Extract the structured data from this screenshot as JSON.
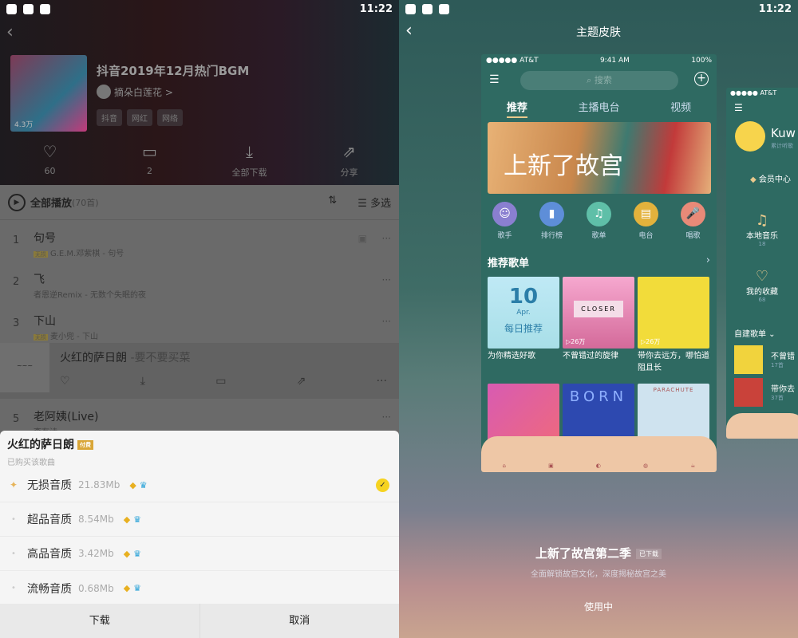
{
  "status": {
    "time": "11:22"
  },
  "left": {
    "playlist": {
      "title": "抖音2019年12月热门BGM",
      "creator": "摘朵白莲花 >",
      "tags": [
        "抖音",
        "网红",
        "网络"
      ],
      "cover_play_count": "4.3万"
    },
    "actions": [
      {
        "icon": "heart-icon",
        "label": "60"
      },
      {
        "icon": "comment-icon",
        "label": "2"
      },
      {
        "icon": "download-icon",
        "label": "全部下载"
      },
      {
        "icon": "share-icon",
        "label": "分享"
      }
    ],
    "play_all": {
      "label": "全部播放",
      "count": "(70首)",
      "multi_select": "多选"
    },
    "songs": [
      {
        "n": "1",
        "title": "句号",
        "sub": "G.E.M.邓紫棋 - 句号",
        "badge": "无损"
      },
      {
        "n": "2",
        "title": "飞",
        "sub": "者恩逆Remix - 无数个失眠的夜",
        "badge": ""
      },
      {
        "n": "3",
        "title": "下山",
        "sub": "麦小兜 - 下山",
        "badge": "无损"
      },
      {
        "n": "4",
        "title": "火红的萨日朗",
        "sub": " -要不要买菜",
        "badge": ""
      },
      {
        "n": "5",
        "title": "老阿姨(Live)",
        "sub": "李有诗",
        "badge": ""
      }
    ],
    "sheet": {
      "title": "火红的萨日朗",
      "badge": "付费",
      "subtitle": "已购买该歌曲",
      "qualities": [
        {
          "name": "无损音质",
          "size": "21.83Mb",
          "selected": true
        },
        {
          "name": "超品音质",
          "size": "8.54Mb",
          "selected": false
        },
        {
          "name": "高品音质",
          "size": "3.42Mb",
          "selected": false
        },
        {
          "name": "流畅音质",
          "size": "0.68Mb",
          "selected": false
        }
      ],
      "download": "下载",
      "cancel": "取消"
    }
  },
  "right": {
    "title": "主题皮肤",
    "preview": {
      "carrier": "●●●●● AT&T",
      "time": "9:41 AM",
      "battery": "100%",
      "search": "搜索",
      "tabs": [
        "推荐",
        "主播电台",
        "视频"
      ],
      "banner": "上新了故宫",
      "categories": [
        {
          "label": "歌手",
          "color": "#8a7fd0"
        },
        {
          "label": "排行榜",
          "color": "#5e8ed8"
        },
        {
          "label": "歌单",
          "color": "#5fbfa8"
        },
        {
          "label": "电台",
          "color": "#e3b23c"
        },
        {
          "label": "唱歌",
          "color": "#e88a78"
        }
      ],
      "section": "推荐歌单",
      "tiles": [
        {
          "caption": "为你精选好歌",
          "day": "10",
          "month": "Apr.",
          "label": "每日推荐",
          "plays": ""
        },
        {
          "caption": "不曾错过的旋律",
          "label": "CLOSER",
          "plays": "26万"
        },
        {
          "caption": "带你去远方，哪怕道阻且长",
          "plays": "26万"
        },
        {
          "caption": ""
        },
        {
          "caption": "",
          "label": "BORN"
        },
        {
          "caption": "",
          "label": "PARACHUTE"
        }
      ]
    },
    "side": {
      "carrier": "●●●●● AT&T",
      "name": "Kuw",
      "sub": "累计听歌",
      "vip": "会员中心",
      "items": [
        {
          "label": "本地音乐",
          "count": "18"
        },
        {
          "label": "我的收藏",
          "count": "68"
        }
      ],
      "my_lists": "自建歌单",
      "lists": [
        {
          "title": "不曾错",
          "count": "17首"
        },
        {
          "title": "带你去",
          "count": "37首"
        }
      ]
    },
    "theme": {
      "name": "上新了故宫第二季",
      "badge": "已下载",
      "desc": "全面解锁故宫文化，深度揭秘故宫之美",
      "action": "使用中"
    }
  }
}
